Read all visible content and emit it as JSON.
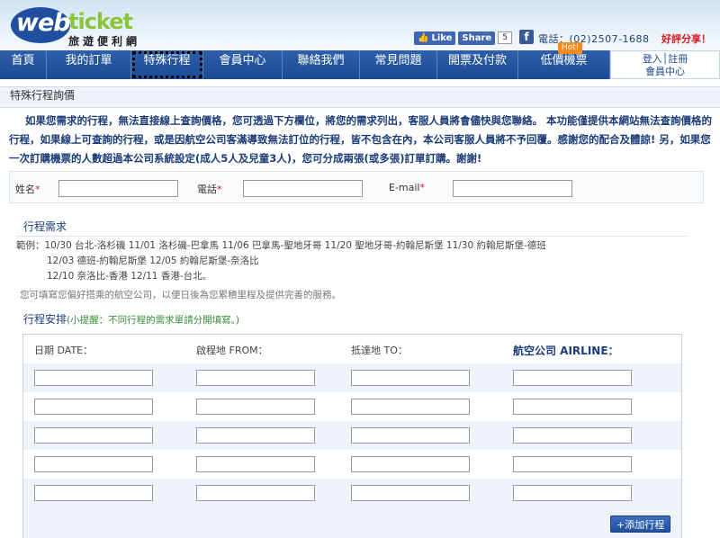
{
  "brand": {
    "web": "web",
    "ticket": "ticket",
    "subtitle": "旅遊便利網"
  },
  "social": {
    "like": "Like",
    "share": "Share",
    "count": "5"
  },
  "header": {
    "phone": "電話：(02)2507-1688",
    "share_good": "好評分享！"
  },
  "nav": {
    "items": [
      "首頁",
      "我的訂單",
      "特殊行程",
      "會員中心",
      "聯絡我們",
      "常見問題",
      "開票及付款",
      "低價機票"
    ],
    "hot": "Hot!",
    "login_line1": "登入│註冊",
    "login_line2": "會員中心"
  },
  "page": {
    "title": "特殊行程詢價",
    "intro": "如果您需求的行程，無法直接線上查詢價格，您可透過下方欄位，將您的需求列出，客服人員將會儘快與您聯絡。 本功能僅提供本網站無法查詢價格的行程，如果線上可查詢的行程，或是因航空公司客滿導致無法訂位的行程，皆不包含在內，本公司客服人員將不予回覆。感謝您的配合及體諒! 另，如果您一次訂購機票的人數超過本公司系統設定(成人5人及兒童3人)，您可分成兩張(或多張)訂單訂購。謝謝!"
  },
  "contact": {
    "name_label": "姓名",
    "phone_label": "電話",
    "email_label": "E-mail",
    "req": "*"
  },
  "itinerary": {
    "section_label": "行程需求",
    "example_line1": "範例：10/30 台北-洛杉磯 11/01 洛杉磯-巴拿馬 11/06 巴拿馬-聖地牙哥 11/20 聖地牙哥-約翰尼斯堡 11/30 約翰尼斯堡-德班",
    "example_line2": "12/03 德班-約翰尼斯堡 12/05 約翰尼斯堡-奈洛比",
    "example_line3": "12/10 奈洛比-香港 12/11 香港-台北。",
    "note": "您可填寫您偏好搭乘的航空公司，以便日後為您累積里程及提供完善的服務。",
    "arrangement_label": "行程安排",
    "arrangement_hint": "(小提醒：不同行程的需求單請分開填寫。)",
    "col_date": "日期 DATE：",
    "col_from": "啟程地 FROM：",
    "col_to": "抵達地 TO：",
    "col_airline": "航空公司 AIRLINE：",
    "add_button": "+添加行程"
  }
}
